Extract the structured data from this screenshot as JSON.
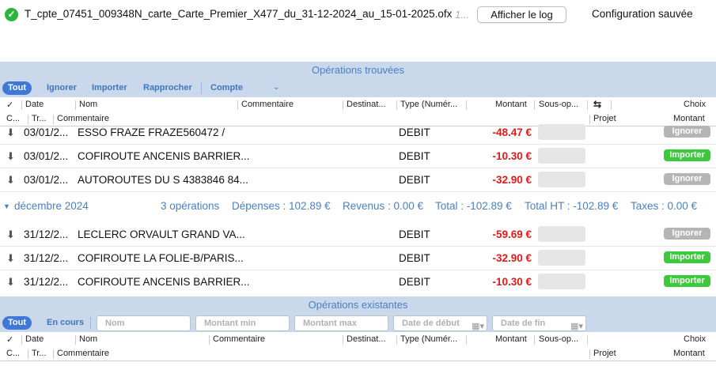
{
  "topbar": {
    "filename": "T_cpte_07451_009348N_carte_Carte_Premier_X477_du_31-12-2024_au_15-01-2025.ofx",
    "ellipsis": "1...",
    "log_button": "Afficher le log",
    "status": "Configuration sauvée"
  },
  "found": {
    "title": "Opérations trouvées",
    "filters": [
      "Tout",
      "Ignorer",
      "Importer",
      "Rapprocher"
    ],
    "account_label": "Compte",
    "columns_row1": [
      "✓",
      "Date",
      "Nom",
      "Commentaire",
      "Destinat...",
      "Type (Numér...",
      "Montant",
      "Sous-op...",
      "Choix"
    ],
    "columns_row2": [
      "C...",
      "Tr...",
      "Commentaire",
      "Projet",
      "Montant"
    ],
    "rows_top": [
      {
        "date": "03/01/2...",
        "name": "ESSO FRAZE FRAZE560472 /",
        "type": "DEBIT",
        "amount": "-48.47 €",
        "choice": "Ignorer"
      },
      {
        "date": "03/01/2...",
        "name": "COFIROUTE ANCENIS BARRIER...",
        "type": "DEBIT",
        "amount": "-10.30 €",
        "choice": "Importer"
      },
      {
        "date": "03/01/2...",
        "name": "AUTOROUTES DU S 4383846 84...",
        "type": "DEBIT",
        "amount": "-32.90 €",
        "choice": "Ignorer"
      }
    ],
    "group": {
      "month": "décembre 2024",
      "count": "3 opérations",
      "expenses": "Dépenses : 102.89 €",
      "income": "Revenus : 0.00 €",
      "total": "Total : -102.89 €",
      "total_ht": "Total HT : -102.89 €",
      "taxes": "Taxes : 0.00 €"
    },
    "rows_group": [
      {
        "date": "31/12/2...",
        "name": "LECLERC ORVAULT GRAND VA...",
        "type": "DEBIT",
        "amount": "-59.69 €",
        "choice": "Ignorer"
      },
      {
        "date": "31/12/2...",
        "name": "COFIROUTE LA FOLIE-B/PARIS...",
        "type": "DEBIT",
        "amount": "-32.90 €",
        "choice": "Importer"
      },
      {
        "date": "31/12/2...",
        "name": "COFIROUTE ANCENIS BARRIER...",
        "type": "DEBIT",
        "amount": "-10.30 €",
        "choice": "Importer"
      }
    ]
  },
  "existing": {
    "title": "Opérations existantes",
    "filters": [
      "Tout",
      "En cours"
    ],
    "placeholders": {
      "name": "Nom",
      "min": "Montant min",
      "max": "Montant max",
      "start": "Date de début",
      "end": "Date de fin"
    },
    "columns_row1": [
      "✓",
      "Date",
      "Nom",
      "Commentaire",
      "Destinat...",
      "Type (Numér...",
      "Montant",
      "Sous-op...",
      "Choix"
    ],
    "columns_row2": [
      "C...",
      "Tr...",
      "Commentaire",
      "Projet",
      "Montant"
    ]
  },
  "colors": {
    "accent": "#3f78d6",
    "band": "#c9d8eb",
    "negative": "#e11a1a",
    "import": "#3cc93c",
    "ignore": "#b5b5b5"
  }
}
